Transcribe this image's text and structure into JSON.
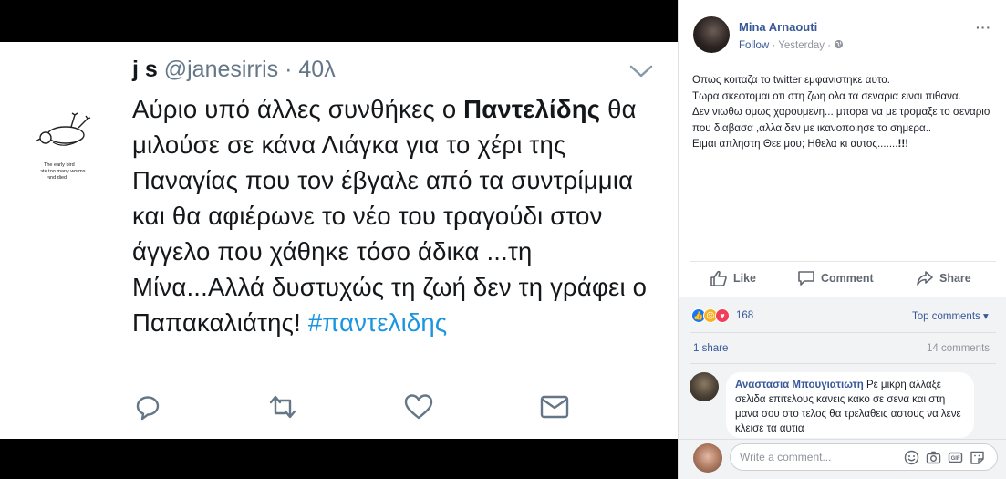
{
  "tweet": {
    "display_name": "j s",
    "handle": "@janesirris",
    "separator": "·",
    "age": "40λ",
    "avatar_caption": "The early bird ate too many worms and died",
    "text_parts": {
      "p1": "Αύριο υπό άλλες συνθήκες ο ",
      "bold": "Παντελίδης",
      "p2": " θα μιλούσε σε κάνα Λιάγκα για το χέρι της Παναγίας που τον έβγαλε από τα συντρίμμια και θα αφιέρωνε το νέο του τραγούδι στον άγγελο που χάθηκε τόσο άδικα ...τη Μίνα...Αλλά δυστυχώς τη ζωή δεν τη γράφει ο Παπακαλιάτης! ",
      "hashtag": "#παντελιδης"
    },
    "actions": [
      "reply-icon",
      "retweet-icon",
      "like-icon",
      "dm-icon"
    ],
    "hashtag_color": "#1b95e0"
  },
  "facebook": {
    "poster": "Mina Arnaouti",
    "follow": "Follow",
    "dot": "·",
    "time": "Yesterday",
    "dot2": "·",
    "more": "···",
    "body_lines": [
      "Οπως κοιταζα το twitter εμφανιστηκε αυτο.",
      "Τωρα σκεφτομαι οτι στη ζωη ολα τα σεναρια ειναι πιθανα.",
      "Δεν νιωθω ομως χαρουμενη... μπορει να με τρομαξε το σεναριο που διαβασα ,αλλα δεν με ικανοποιησε το σημερα..",
      "Ειμαι απληστη Θεε μου; Ηθελα κι αυτος.......",
      "!!!"
    ],
    "actions": {
      "like": "Like",
      "comment": "Comment",
      "share": "Share"
    },
    "reaction_count": "168",
    "top_comments": "Top comments ▾",
    "shares": "1 share",
    "comments_count": "14 comments",
    "comment": {
      "author": "Αναστασια Μπουγιατιωτη",
      "text": " Ρε μικρη αλλαξε σελιδα επιτελους κανεις κακο σε σενα και στη μανα σου στο τελος θα τρελαθεις αστους να λενε κλεισε τα αυτια"
    },
    "write_placeholder": "Write a comment...",
    "link_color": "#385898"
  }
}
